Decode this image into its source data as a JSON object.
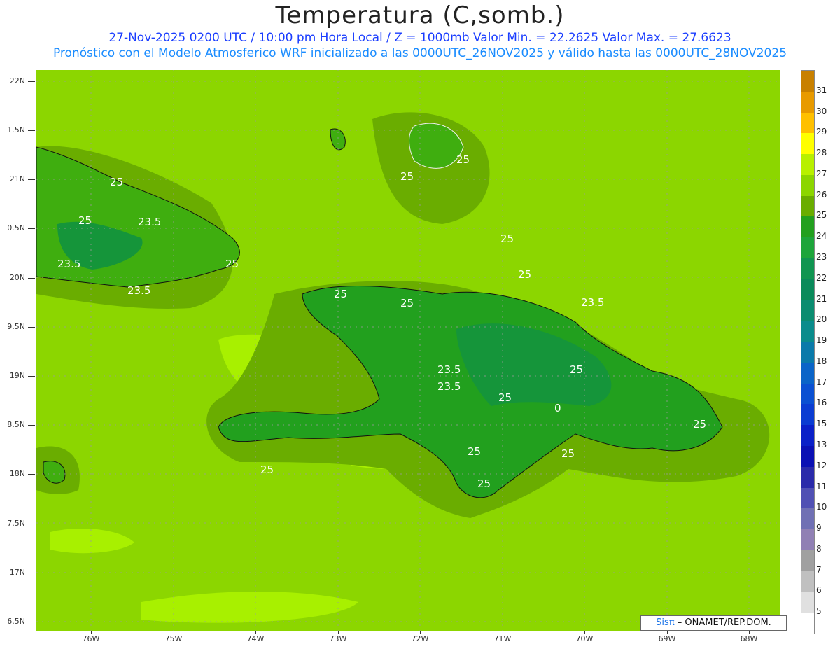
{
  "header": {
    "title": "Temperatura (C,somb.)",
    "subtitle_1": "27-Nov-2025 0200 UTC / 10:00 pm Hora Local / Z = 1000mb   Valor Min. = 22.2625   Valor Max. = 27.6623",
    "subtitle_2": "Pronóstico con el Modelo Atmosferico WRF inicializado a las 0000UTC_26NOV2025 y válido hasta las  0000UTC_28NOV2025"
  },
  "map": {
    "lat_labels": [
      "22N",
      "1.5N",
      "21N",
      "0.5N",
      "20N",
      "9.5N",
      "19N",
      "8.5N",
      "18N",
      "7.5N",
      "17N",
      "6.5N"
    ],
    "lon_labels": [
      "76W",
      "75W",
      "74W",
      "73W",
      "72W",
      "71W",
      "70W",
      "69W",
      "68W"
    ],
    "contour_labels": [
      "25",
      "25",
      "23.5",
      "23.5",
      "23.5",
      "25",
      "25",
      "25",
      "25",
      "25",
      "25",
      "25",
      "23.5",
      "23.5",
      "23.5",
      "25",
      "25",
      "25",
      "25",
      "25",
      "25",
      "25",
      "0"
    ],
    "colors": {
      "sea_warm": "#8cd600",
      "sea_warmer": "#a8f000",
      "land_26": "#6aad00",
      "land_25": "#3fae0f",
      "land_24": "#22a01e",
      "land_23": "#15953a"
    }
  },
  "colorbar": {
    "labels": [
      "31",
      "30",
      "29",
      "28",
      "27",
      "26",
      "25",
      "24",
      "23",
      "22",
      "21",
      "20",
      "19",
      "18",
      "17",
      "16",
      "15",
      "13",
      "12",
      "11",
      "10",
      "9",
      "8",
      "7",
      "6",
      "5"
    ],
    "colors": [
      "#c88000",
      "#e89a00",
      "#ffc000",
      "#ffff00",
      "#b8f000",
      "#8cd600",
      "#6aad00",
      "#22a01e",
      "#1da53a",
      "#109550",
      "#0a8a5a",
      "#0a8c70",
      "#0a8c8c",
      "#0a7aaa",
      "#0a64c8",
      "#0a50d2",
      "#0a3cd2",
      "#0a20c8",
      "#0a10b4",
      "#2a2aaa",
      "#5050b4",
      "#7070b4",
      "#9080b4",
      "#a0a0a0",
      "#c0c0c0",
      "#e0e0e0",
      "#ffffff"
    ]
  },
  "credit": {
    "brand": "Sis",
    "pi": "π",
    "org": "– ONAMET/REP.DOM."
  }
}
